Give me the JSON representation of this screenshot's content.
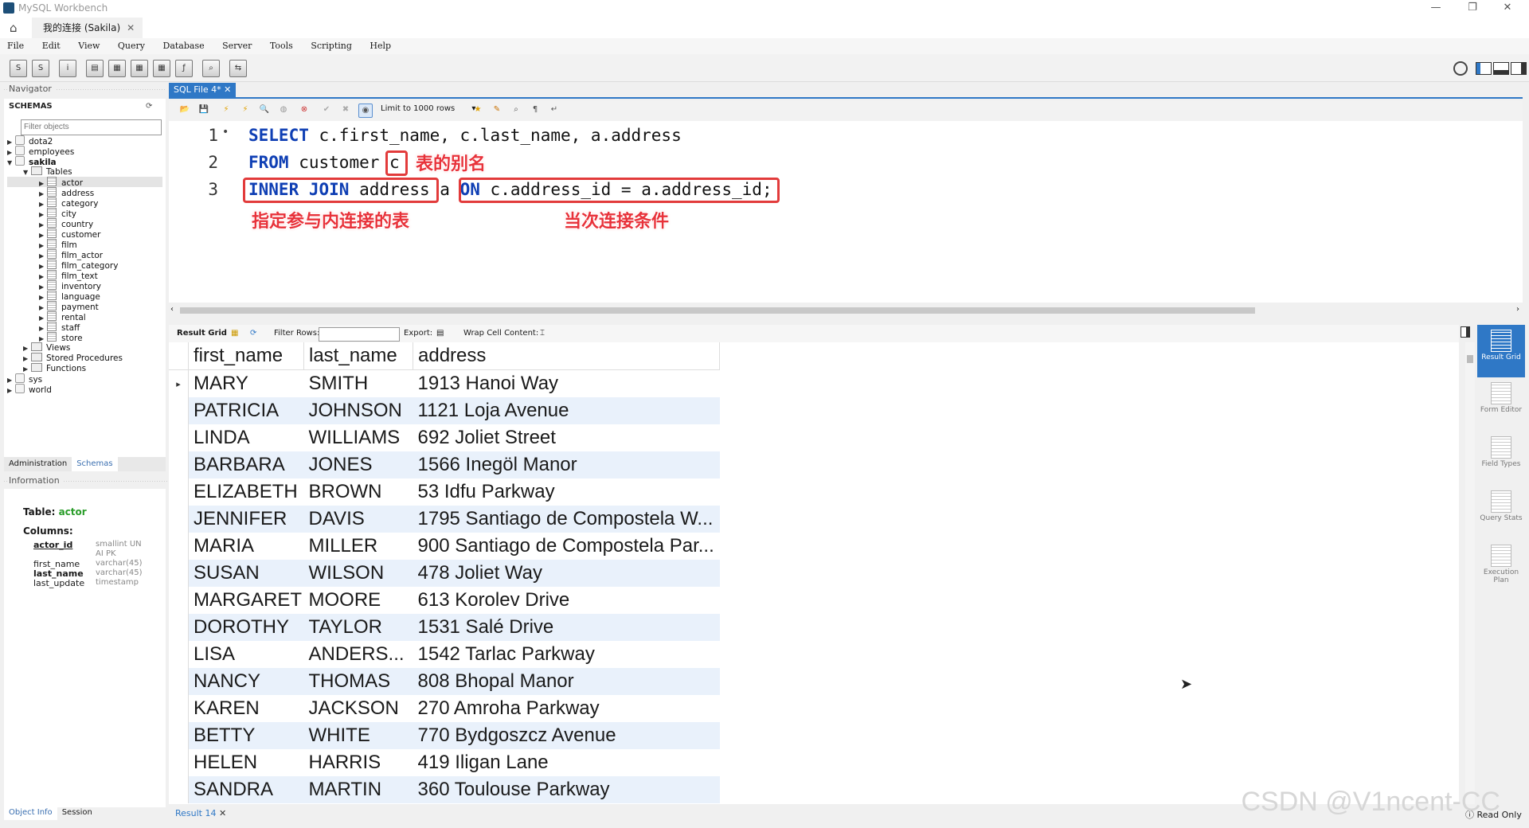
{
  "window": {
    "title": "MySQL Workbench",
    "connection_tab": "我的连接 (Sakila)"
  },
  "menu": [
    "File",
    "Edit",
    "View",
    "Query",
    "Database",
    "Server",
    "Tools",
    "Scripting",
    "Help"
  ],
  "navigator": {
    "header": "Navigator",
    "schemas_label": "SCHEMAS",
    "filter_placeholder": "Filter objects",
    "schemas": [
      "dota2",
      "employees",
      "sakila"
    ],
    "tables_label": "Tables",
    "tables": [
      "actor",
      "address",
      "category",
      "city",
      "country",
      "customer",
      "film",
      "film_actor",
      "film_category",
      "film_text",
      "inventory",
      "language",
      "payment",
      "rental",
      "staff",
      "store"
    ],
    "sakila_children": [
      "Views",
      "Stored Procedures",
      "Functions"
    ],
    "more_schemas": [
      "sys",
      "world"
    ],
    "tabs": [
      "Administration",
      "Schemas"
    ],
    "info_header": "Information",
    "info": {
      "table_label": "Table:",
      "table_name": "actor",
      "columns_label": "Columns:",
      "columns": [
        {
          "name": "actor_id",
          "type": "smallint UN AI PK"
        },
        {
          "name": "first_name",
          "type": "varchar(45)"
        },
        {
          "name": "last_name",
          "type": "varchar(45)"
        },
        {
          "name": "last_update",
          "type": "timestamp"
        }
      ]
    },
    "bottom_tabs": [
      "Object Info",
      "Session"
    ]
  },
  "editor": {
    "tab_label": "SQL File 4*",
    "limit_label": "Limit to 1000 rows",
    "lines": [
      {
        "num": "1",
        "code": "SELECT c.first_name, c.last_name, a.address"
      },
      {
        "num": "2",
        "code": "FROM customer c"
      },
      {
        "num": "3",
        "code": "INNER JOIN address a ON c.address_id = a.address_id;"
      }
    ],
    "annotations": {
      "alias": "表的别名",
      "join_table": "指定参与内连接的表",
      "join_condition": "当次连接条件"
    }
  },
  "result_toolbar": {
    "result_grid": "Result Grid",
    "filter_rows": "Filter Rows:",
    "export": "Export:",
    "wrap": "Wrap Cell Content:"
  },
  "grid": {
    "columns": [
      "first_name",
      "last_name",
      "address"
    ],
    "rows": [
      [
        "MARY",
        "SMITH",
        "1913 Hanoi Way"
      ],
      [
        "PATRICIA",
        "JOHNSON",
        "1121 Loja Avenue"
      ],
      [
        "LINDA",
        "WILLIAMS",
        "692 Joliet Street"
      ],
      [
        "BARBARA",
        "JONES",
        "1566 Inegöl Manor"
      ],
      [
        "ELIZABETH",
        "BROWN",
        "53 Idfu Parkway"
      ],
      [
        "JENNIFER",
        "DAVIS",
        "1795 Santiago de Compostela W..."
      ],
      [
        "MARIA",
        "MILLER",
        "900 Santiago de Compostela Par..."
      ],
      [
        "SUSAN",
        "WILSON",
        "478 Joliet Way"
      ],
      [
        "MARGARET",
        "MOORE",
        "613 Korolev Drive"
      ],
      [
        "DOROTHY",
        "TAYLOR",
        "1531 Salé Drive"
      ],
      [
        "LISA",
        "ANDERS...",
        "1542 Tarlac Parkway"
      ],
      [
        "NANCY",
        "THOMAS",
        "808 Bhopal Manor"
      ],
      [
        "KAREN",
        "JACKSON",
        "270 Amroha Parkway"
      ],
      [
        "BETTY",
        "WHITE",
        "770 Bydgoszcz Avenue"
      ],
      [
        "HELEN",
        "HARRIS",
        "419 Iligan Lane"
      ],
      [
        "SANDRA",
        "MARTIN",
        "360 Toulouse Parkway"
      ]
    ]
  },
  "right_panel": [
    "Result Grid",
    "Form Editor",
    "Field Types",
    "Query Stats",
    "Execution Plan"
  ],
  "bottom": {
    "result_tab": "Result 14",
    "read_only": "Read Only"
  },
  "watermark": "CSDN @V1ncent-CC"
}
